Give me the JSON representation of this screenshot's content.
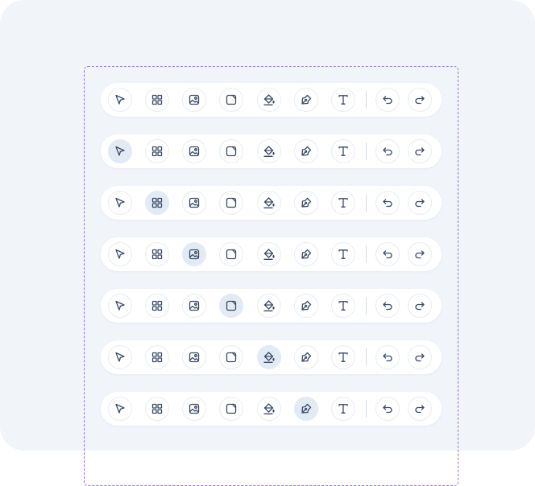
{
  "canvas": {
    "background": "#f1f5fa",
    "selection_outline": "#9b6ce8"
  },
  "toolbar_tools": [
    {
      "id": "select",
      "icon": "cursor-arrow-icon"
    },
    {
      "id": "components",
      "icon": "grid-icon"
    },
    {
      "id": "image",
      "icon": "image-icon"
    },
    {
      "id": "frame",
      "icon": "frame-icon"
    },
    {
      "id": "fill",
      "icon": "paint-bucket-icon"
    },
    {
      "id": "pen",
      "icon": "pen-icon"
    },
    {
      "id": "text",
      "icon": "text-icon"
    },
    {
      "id": "undo",
      "icon": "undo-icon"
    },
    {
      "id": "redo",
      "icon": "redo-icon"
    }
  ],
  "toolbar_variants": [
    {
      "active": null
    },
    {
      "active": "select"
    },
    {
      "active": "components"
    },
    {
      "active": "image"
    },
    {
      "active": "frame"
    },
    {
      "active": "fill"
    },
    {
      "active": "pen"
    }
  ],
  "colors": {
    "active_bg": "#e2ebf4",
    "icon": "#3b4a66",
    "button_border": "#e7edf4"
  }
}
